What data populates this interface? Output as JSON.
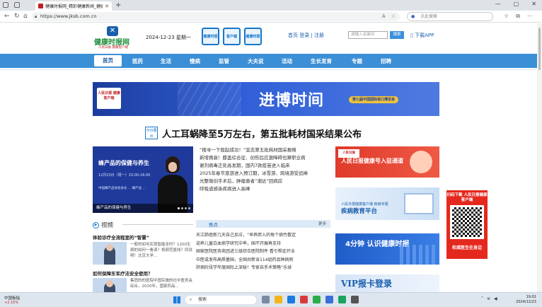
{
  "browser": {
    "tab_title": "健康时报网_精彩健康新闻_健康资讯",
    "new_tab": "+",
    "url": "https://www.jksb.com.cn",
    "search_placeholder": "点此搜索",
    "window_controls": [
      "—",
      "▢",
      "✕"
    ]
  },
  "header": {
    "logo_name": "健康时报网",
    "logo_sub": "人民日报 健康客户端",
    "date": "2024-12-23 星期一",
    "quick_icons": [
      "健康时报",
      "客户端",
      "健康时报"
    ],
    "login_text": "首页 登录 | 注册",
    "keyword_placeholder": "请输入关键词",
    "search_button": "搜索",
    "app_link": "下载APP"
  },
  "nav": {
    "items": [
      "首页",
      "医药",
      "生活",
      "慢病",
      "监管",
      "大夫说",
      "活动",
      "生长发育",
      "专题",
      "招聘"
    ]
  },
  "banner": {
    "logo": "人民日报 健康客户端",
    "title": "进博时间",
    "pill": "第七届中国国际进口博览会"
  },
  "headline": {
    "today_label": "今日要点",
    "text": "人工耳蜗降至5万左右，第五批耗材国采结果公布"
  },
  "feature": {
    "title": "蜂产品的保健与养生",
    "subtitle": "12月23日（周一）15:00-16:00",
    "lines": "中国蜂产品协会会长 ... 蜂产品 ...",
    "caption": "蜂产品的保健与养生"
  },
  "news": [
    "“搜寻一下般起成功！”宣志第五批耗材国采报络",
    "新增再衰！膝盖综合征、创伤后应激障碍也算职业病",
    "谢刘病毒正处高发期，国内7款疫苗进入临床",
    "2025年春节旅游进入预订期，冰雪游、跨境游受追捧",
    "光整微创手术后，肿瘤患者“潮达”回病房",
    "呼吸道感染疾病进入高峰"
  ],
  "ads": {
    "ad1_logo": "人民日报",
    "ad1_text": "人民日报健康号入驻通道",
    "ad2_small": "人民日报健康客户端·疾病专题",
    "ad2_text": "疾病教育平台",
    "ad3_text": "4分钟 认识健康时报",
    "ad4_text": "VIP报卡登录"
  },
  "qr": {
    "top": "扫码下载 人民日报健康客户端",
    "bottom": "权威医生在身边"
  },
  "video": {
    "label": "视频",
    "items": [
      {
        "title": "体验诊疗全流程里的“智慧”",
        "desc": "一般的如何实现智能全时？1200生病的如何一看读？视频范医线？同说明！北京大学..."
      },
      {
        "title": "如何保障东军疗法安全使用？",
        "desc": "集团的的医院中国实施的社中医务会综合，2020年，国家药品..."
      }
    ]
  },
  "focus": {
    "label": "焦点",
    "more": "更多",
    "items": [
      "天江肺癌新几天自己反应，“早养胖入的每个病竹散定",
      "迎养儿童白血病学研究中率，国不开展再支持",
      "国家医院医务商团进三级综合医院制件 看引帮症开业",
      "中医或发布高质量国，全国共新含114组药品种病例",
      "肝病阶段学年度国际上深秘！专家自手术策略“乐球"
    ]
  },
  "taskbar": {
    "weather_temp": "中国板指",
    "weather_change": "+2.15%",
    "search": "搜索",
    "time": "19:01",
    "date": "2024/12/23"
  }
}
